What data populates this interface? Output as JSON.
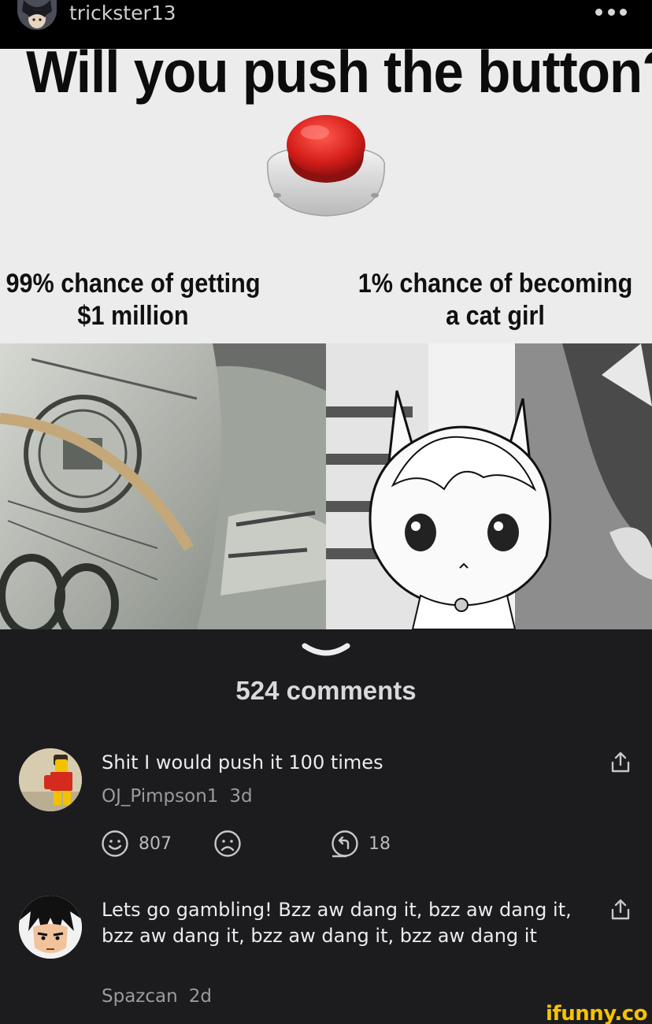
{
  "header": {
    "username": "trickster13",
    "more_icon": "more-horizontal-icon"
  },
  "meme": {
    "title": "Will you push the button?",
    "option_left_line1": "99% chance of getting",
    "option_left_line2": "$1 million",
    "option_right_line1": "1% chance of becoming",
    "option_right_line2": "a cat girl"
  },
  "comments_section": {
    "count_label": "524 comments",
    "collapse_icon": "chevron-down-icon"
  },
  "comments": [
    {
      "text": "Shit I would push it 100 times",
      "author": "OJ_Pimpson1",
      "time": "3d",
      "smile_count": "807",
      "reply_count": "18"
    },
    {
      "text": "Lets go gambling! Bzz aw dang it, bzz aw dang it, bzz aw dang it, bzz aw dang it, bzz aw dang it",
      "author": "Spazcan",
      "time": "2d"
    }
  ],
  "watermark": "ifunny.co",
  "colors": {
    "background": "#1c1c1e",
    "topbar": "#000000",
    "watermark": "#f5c200",
    "button_red": "#d8201c"
  }
}
